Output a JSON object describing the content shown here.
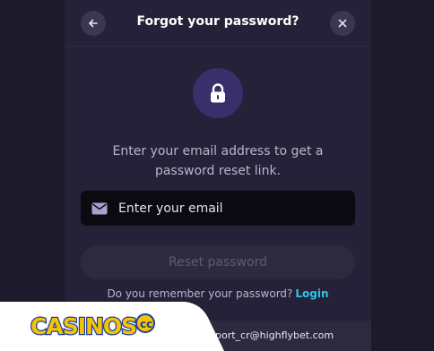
{
  "modal": {
    "title": "Forgot your password?",
    "description_line1": "Enter your email address to get a",
    "description_line2": "password reset link.",
    "email_placeholder": "Enter your email",
    "reset_button_label": "Reset password",
    "remember_text": "Do you remember your password?",
    "login_link_label": "Login",
    "support_email_fragment": "port_cr@highflybet.com"
  },
  "icons": {
    "back": "arrow-left-icon",
    "close": "close-icon",
    "lock": "lock-icon",
    "mail": "mail-icon"
  },
  "watermark": {
    "text": "CASINOS.cc"
  },
  "colors": {
    "background": "#1c1a2b",
    "modal": "#242138",
    "accent_link": "#2bc4e8",
    "lock_circle": "#3a2f6a",
    "input_bg": "#0b0a10",
    "button_disabled": "#2d2a40"
  }
}
